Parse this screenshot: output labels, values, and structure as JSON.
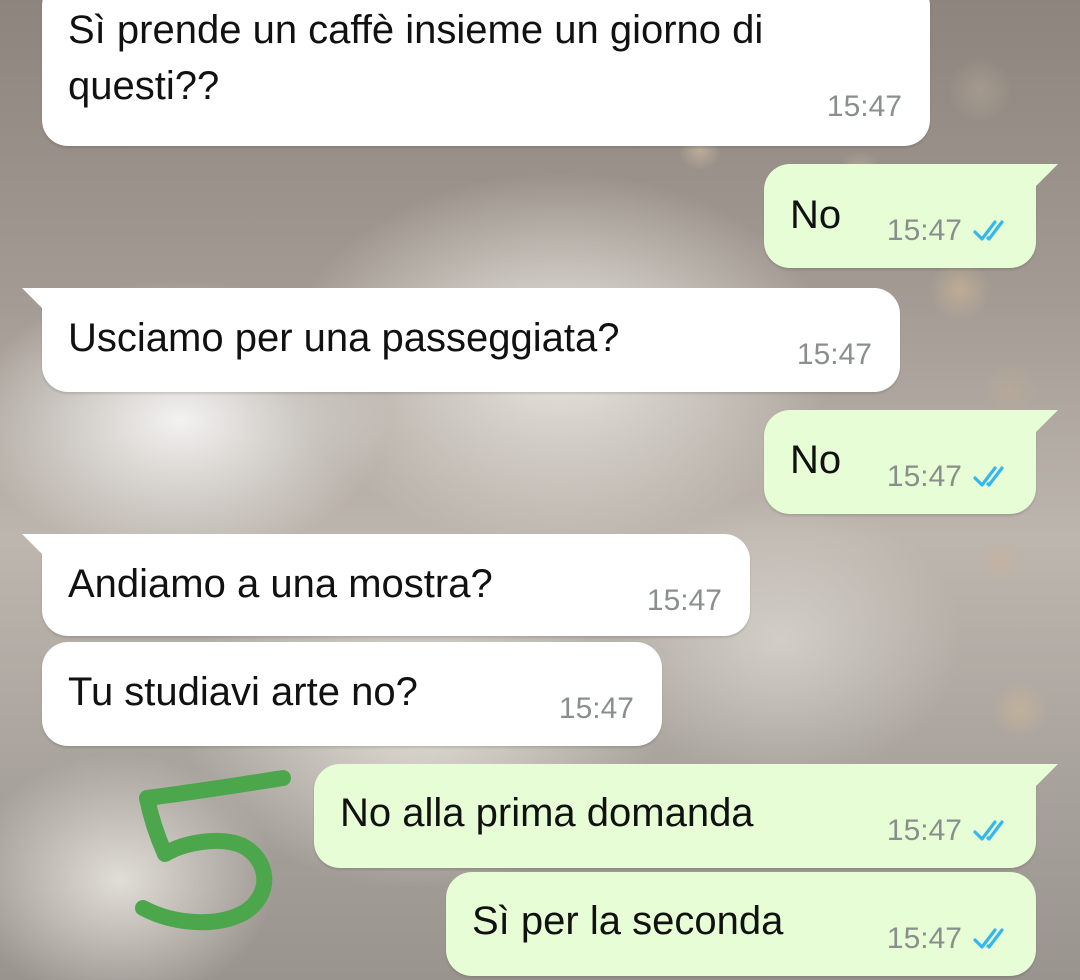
{
  "messages": [
    {
      "direction": "in",
      "text": "Sì prende un caffè insieme un giorno di questi??",
      "time": "15:47"
    },
    {
      "direction": "out",
      "text": "No",
      "time": "15:47",
      "status": "read"
    },
    {
      "direction": "in",
      "text": "Usciamo per una passeggiata?",
      "time": "15:47"
    },
    {
      "direction": "out",
      "text": "No",
      "time": "15:47",
      "status": "read"
    },
    {
      "direction": "in",
      "text": "Andiamo a una mostra?",
      "time": "15:47"
    },
    {
      "direction": "in",
      "text": "Tu studiavi arte no?",
      "time": "15:47"
    },
    {
      "direction": "out",
      "text": "No alla prima domanda",
      "time": "15:47",
      "status": "read"
    },
    {
      "direction": "out",
      "text": "Sì per la seconda",
      "time": "15:47",
      "status": "read"
    }
  ],
  "annotation": {
    "text": "5",
    "color": "#4ca64c"
  },
  "colors": {
    "incoming_bubble": "#ffffff",
    "outgoing_bubble": "#e7fdd5",
    "timestamp": "#8a8f8d",
    "read_ticks": "#34b7f1"
  },
  "icons": {
    "read_status": "double-check-icon"
  }
}
